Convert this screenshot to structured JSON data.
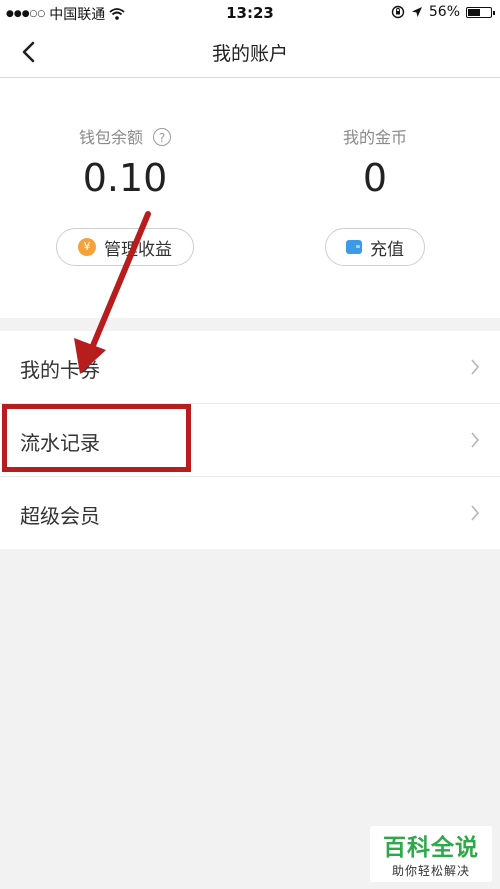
{
  "status_bar": {
    "signal": "●●●○○",
    "carrier": "中国联通",
    "time": "13:23",
    "battery": "56%",
    "battery_level": 0.56
  },
  "nav": {
    "title": "我的账户"
  },
  "account": {
    "wallet": {
      "label": "钱包余额",
      "help_glyph": "?",
      "value": "0.10",
      "button_label": "管理收益",
      "button_icon_glyph": "¥"
    },
    "coins": {
      "label": "我的金币",
      "value": "0",
      "button_label": "充值"
    }
  },
  "menu": {
    "items": [
      {
        "label": "我的卡券"
      },
      {
        "label": "流水记录"
      },
      {
        "label": "超级会员"
      }
    ]
  },
  "watermark": {
    "title": "百科全说",
    "subtitle": "助你轻松解决"
  },
  "colors": {
    "annotation": "#b81d1d",
    "coin": "#f5a23a",
    "wallet": "#3d9ae8",
    "brand_green": "#2fa84a"
  }
}
